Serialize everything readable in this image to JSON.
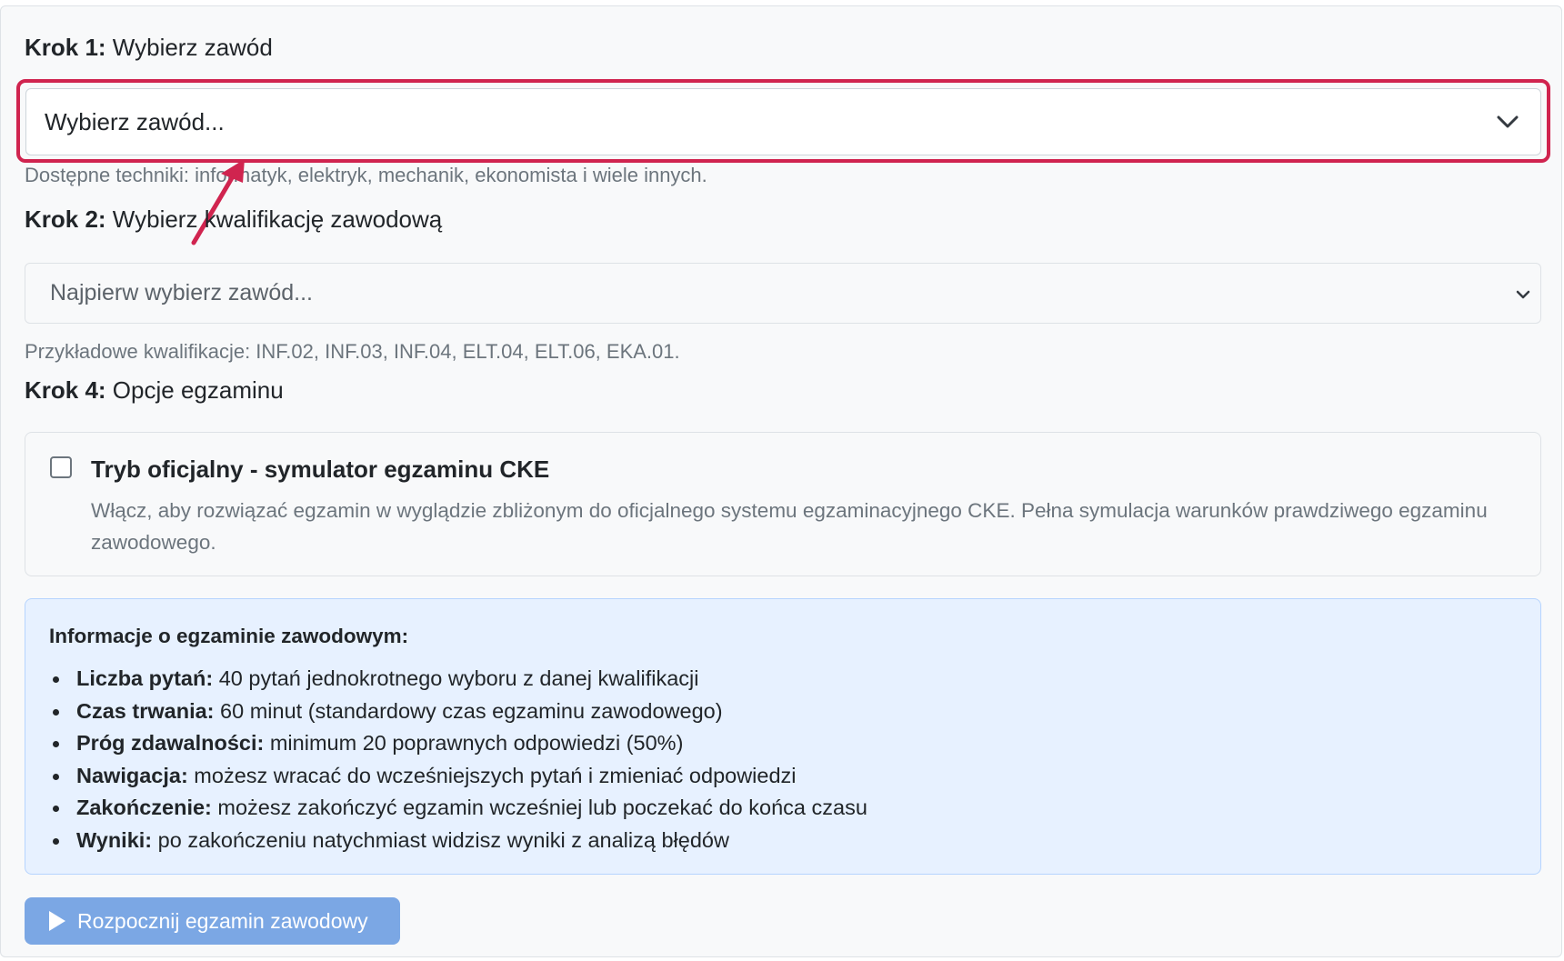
{
  "step1": {
    "label_bold": "Krok 1:",
    "label_text": " Wybierz zawód",
    "select_value": "Wybierz zawód...",
    "hint": "Dostępne techniki: informatyk, elektryk, mechanik, ekonomista i wiele innych.",
    "highlight_color": "#d0244f"
  },
  "step2": {
    "label_bold": "Krok 2:",
    "label_text": " Wybierz kwalifikację zawodową",
    "select_value": "Najpierw wybierz zawód...",
    "hint": "Przykładowe kwalifikacje: INF.02, INF.03, INF.04, ELT.04, ELT.06, EKA.01."
  },
  "step4": {
    "label_bold": "Krok 4:",
    "label_text": " Opcje egzaminu",
    "official_mode": {
      "checked": false,
      "title": "Tryb oficjalny - symulator egzaminu CKE",
      "description": "Włącz, aby rozwiązać egzamin w wyglądzie zbliżonym do oficjalnego systemu egzaminacyjnego CKE. Pełna symulacja warunków prawdziwego egzaminu zawodowego."
    }
  },
  "info": {
    "title": "Informacje o egzaminie zawodowym:",
    "items": [
      {
        "key": "Liczba pytań:",
        "value": " 40 pytań jednokrotnego wyboru z danej kwalifikacji"
      },
      {
        "key": "Czas trwania:",
        "value": " 60 minut (standardowy czas egzaminu zawodowego)"
      },
      {
        "key": "Próg zdawalności:",
        "value": " minimum 20 poprawnych odpowiedzi (50%)"
      },
      {
        "key": "Nawigacja:",
        "value": " możesz wracać do wcześniejszych pytań i zmieniać odpowiedzi"
      },
      {
        "key": "Zakończenie:",
        "value": " możesz zakończyć egzamin wcześniej lub poczekać do końca czasu"
      },
      {
        "key": "Wyniki:",
        "value": " po zakończeniu natychmiast widzisz wyniki z analizą błędów"
      }
    ]
  },
  "start_button": {
    "label": "Rozpocznij egzamin zawodowy",
    "icon": "play-icon",
    "color": "#7ba7e4"
  }
}
